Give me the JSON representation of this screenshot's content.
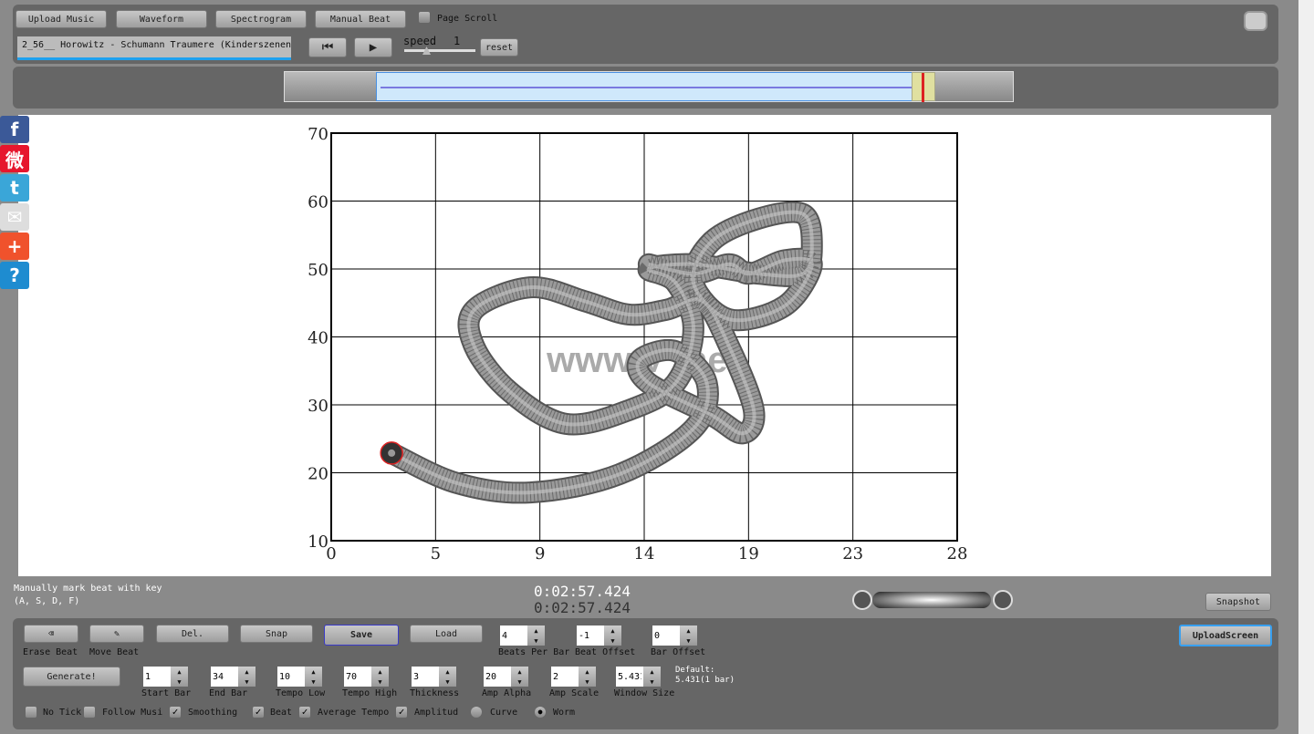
{
  "toolbar": {
    "upload_music": "Upload Music",
    "waveform": "Waveform",
    "spectrogram": "Spectrogram",
    "manual_beat": "Manual Beat",
    "page_scroll": "Page Scroll",
    "song": "2_56__ Horowitz - Schumann Traumere   (Kinderszenen",
    "speed_label": "speed",
    "speed_value": "1",
    "reset": "reset"
  },
  "social": [
    {
      "icon": "facebook-icon",
      "glyph": "f",
      "color": "#3b5998"
    },
    {
      "icon": "weibo-icon",
      "glyph": "微",
      "color": "#e6162d"
    },
    {
      "icon": "twitter-icon",
      "glyph": "t",
      "color": "#3aa6d8"
    },
    {
      "icon": "mail-icon",
      "glyph": "✉",
      "color": "#ddd"
    },
    {
      "icon": "add-icon",
      "glyph": "+",
      "color": "#f0522c"
    },
    {
      "icon": "help-icon",
      "glyph": "?",
      "color": "#1e8cd0"
    }
  ],
  "plot": {
    "xticks": [
      "0",
      "5",
      "9",
      "14",
      "19",
      "23",
      "28"
    ],
    "yticks": [
      "70",
      "60",
      "50",
      "40",
      "30",
      "20",
      "10"
    ],
    "xlim": [
      0,
      28
    ],
    "ylim": [
      10,
      70
    ],
    "watermark": "www.V    .net",
    "worm": [
      [
        2.7,
        22.9
      ],
      [
        5.6,
        18.5
      ],
      [
        8.9,
        17.1
      ],
      [
        12.9,
        19.8
      ],
      [
        16.2,
        26.5
      ],
      [
        16.8,
        33.2
      ],
      [
        15.4,
        37.9
      ],
      [
        13.8,
        36.6
      ],
      [
        14.2,
        33.2
      ],
      [
        17.0,
        28.5
      ],
      [
        18.4,
        25.8
      ],
      [
        18.9,
        29.2
      ],
      [
        17.8,
        38.6
      ],
      [
        16.6,
        45.3
      ],
      [
        15.0,
        44.0
      ],
      [
        13.3,
        43.3
      ],
      [
        11.3,
        45.3
      ],
      [
        8.9,
        47.3
      ],
      [
        6.4,
        44.0
      ],
      [
        6.4,
        38.6
      ],
      [
        8.0,
        31.9
      ],
      [
        10.5,
        27.2
      ],
      [
        13.3,
        29.2
      ],
      [
        15.4,
        33.2
      ],
      [
        16.2,
        41.3
      ],
      [
        15.4,
        48.0
      ],
      [
        14.2,
        50.0
      ],
      [
        16.2,
        50.7
      ],
      [
        19.1,
        49.3
      ],
      [
        21.1,
        49.3
      ],
      [
        21.5,
        53.4
      ],
      [
        21.1,
        58.1
      ],
      [
        19.1,
        57.4
      ],
      [
        17.0,
        54.0
      ],
      [
        16.2,
        48.0
      ],
      [
        17.8,
        42.6
      ],
      [
        20.3,
        44.6
      ],
      [
        21.5,
        50.7
      ],
      [
        20.3,
        51.3
      ],
      [
        18.7,
        49.3
      ],
      [
        17.8,
        50.7
      ],
      [
        16.2,
        49.3
      ],
      [
        14.2,
        50.7
      ]
    ]
  },
  "status": {
    "hint_line1": "Manually mark beat with key",
    "hint_line2": "(A, S, D, F)",
    "time1": "0:02:57.424",
    "time2": "0:02:57.424",
    "snapshot": "Snapshot"
  },
  "controls": {
    "erase_beat": "Erase Beat",
    "move_beat": "Move Beat",
    "del": "Del.",
    "snap": "Snap",
    "save": "Save",
    "load": "Load",
    "upload_screen": "UploadScreen",
    "generate": "Generate!",
    "beats_per_bar": {
      "label": "Beats Per Bar",
      "value": "4"
    },
    "beat_offset": {
      "label": "Beat Offset",
      "value": "-1"
    },
    "bar_offset": {
      "label": "Bar Offset",
      "value": "0"
    },
    "start_bar": {
      "label": "Start Bar",
      "value": "1"
    },
    "end_bar": {
      "label": "End Bar",
      "value": "34"
    },
    "tempo_low": {
      "label": "Tempo Low",
      "value": "10"
    },
    "tempo_high": {
      "label": "Tempo High",
      "value": "70"
    },
    "thickness": {
      "label": "Thickness",
      "value": "3"
    },
    "amp_alpha": {
      "label": "Amp Alpha",
      "value": "20"
    },
    "amp_scale": {
      "label": "Amp Scale",
      "value": "2"
    },
    "window_size": {
      "label": "Window Size",
      "value": "5.431"
    },
    "default_line1": "Default:",
    "default_line2": "5.431(1 bar)",
    "no_tick": "No Tick",
    "follow_music": "Follow Musi",
    "smoothing": "Smoothing",
    "beat": "Beat",
    "average_tempo": "Average Tempo",
    "amplitude": "Amplitud",
    "curve": "Curve",
    "worm": "Worm"
  }
}
